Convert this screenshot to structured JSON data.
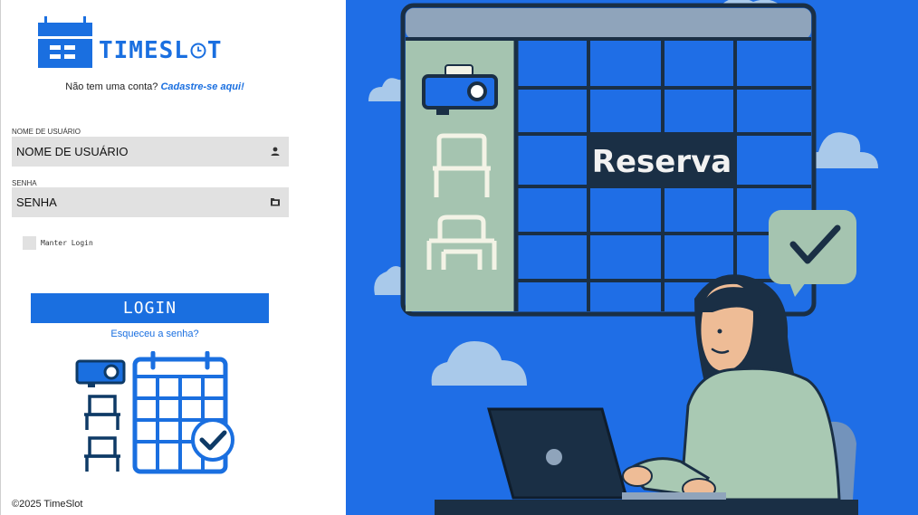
{
  "brand": {
    "name_part1": "TIMESL",
    "name_part2": "T",
    "color": "#1a6fe0"
  },
  "signup": {
    "prompt": "Não tem uma conta?",
    "link": "Cadastre-se aqui!"
  },
  "username": {
    "label": "NOME DE USUÁRIO",
    "placeholder": "NOME DE USUÁRIO",
    "icon": "user-icon"
  },
  "password": {
    "label": "SENHA",
    "placeholder": "SENHA",
    "icon": "folder-icon"
  },
  "remember": {
    "label": "Manter Login"
  },
  "login": {
    "label": "LOGIN"
  },
  "forgot": {
    "label": "Esqueceu a senha?"
  },
  "footer": {
    "copyright": "©2025 TimeSlot"
  },
  "hero": {
    "cell_label": "Reserva",
    "background": "#1f6ee6"
  }
}
